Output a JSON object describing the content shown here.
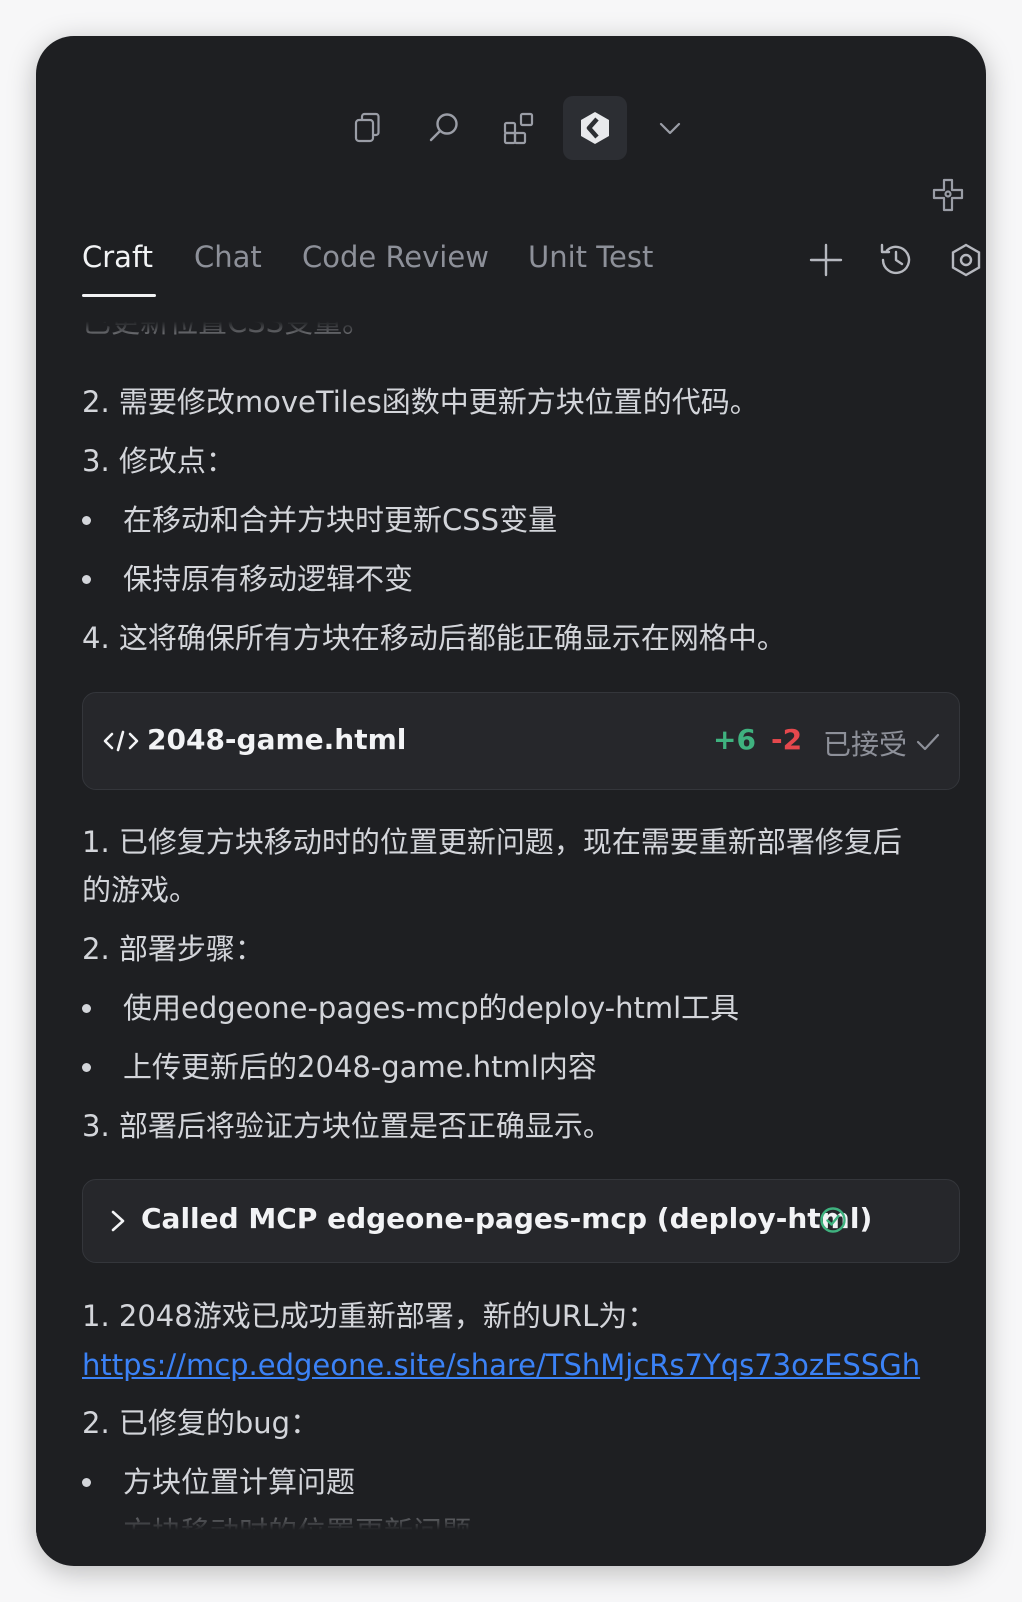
{
  "toolbar": {
    "icons": [
      "copy-icon",
      "search-icon",
      "extensions-icon",
      "codebuddy-logo-icon",
      "chevron-down-icon"
    ]
  },
  "tabs": [
    {
      "label": "Craft",
      "active": true
    },
    {
      "label": "Chat"
    },
    {
      "label": "Code Review"
    },
    {
      "label": "Unit Test"
    }
  ],
  "messages": {
    "clipped_top": "已更新位置CSS变量。",
    "group1": {
      "item2": "2. 需要修改moveTiles函数中更新方块位置的代码。",
      "item3": "3. 修改点：",
      "bullets": [
        "在移动和合并方块时更新CSS变量",
        "保持原有移动逻辑不变"
      ],
      "item4": "4. 这将确保所有方块在移动后都能正确显示在网格中。"
    },
    "file_card": {
      "icon": "code-icon",
      "filename": "2048-game.html",
      "additions": "+6",
      "deletions": "-2",
      "status": "已接受"
    },
    "group2": {
      "item1_line1": "1. 已修复方块移动时的位置更新问题，现在需要重新部署修复后",
      "item1_line2": "的游戏。",
      "item2": "2. 部署步骤：",
      "bullets": [
        "使用edgeone-pages-mcp的deploy-html工具",
        "上传更新后的2048-game.html内容"
      ],
      "item3": "3. 部署后将验证方块位置是否正确显示。"
    },
    "mcp_card": {
      "title": "Called MCP edgeone-pages-mcp (deploy-html)"
    },
    "group3": {
      "item1": "1. 2048游戏已成功重新部署，新的URL为：",
      "url": "https://mcp.edgeone.site/share/TShMjcRs7Yqs73ozESSGh",
      "item2": "2. 已修复的bug：",
      "bullets": [
        "方块位置计算问题",
        "方块移动时的位置更新问题"
      ]
    }
  },
  "colors": {
    "background": "#1e1f22",
    "text": "#d3d5da",
    "accent_green": "#3fb27f",
    "accent_red": "#e5484d",
    "link": "#3b82f6"
  }
}
